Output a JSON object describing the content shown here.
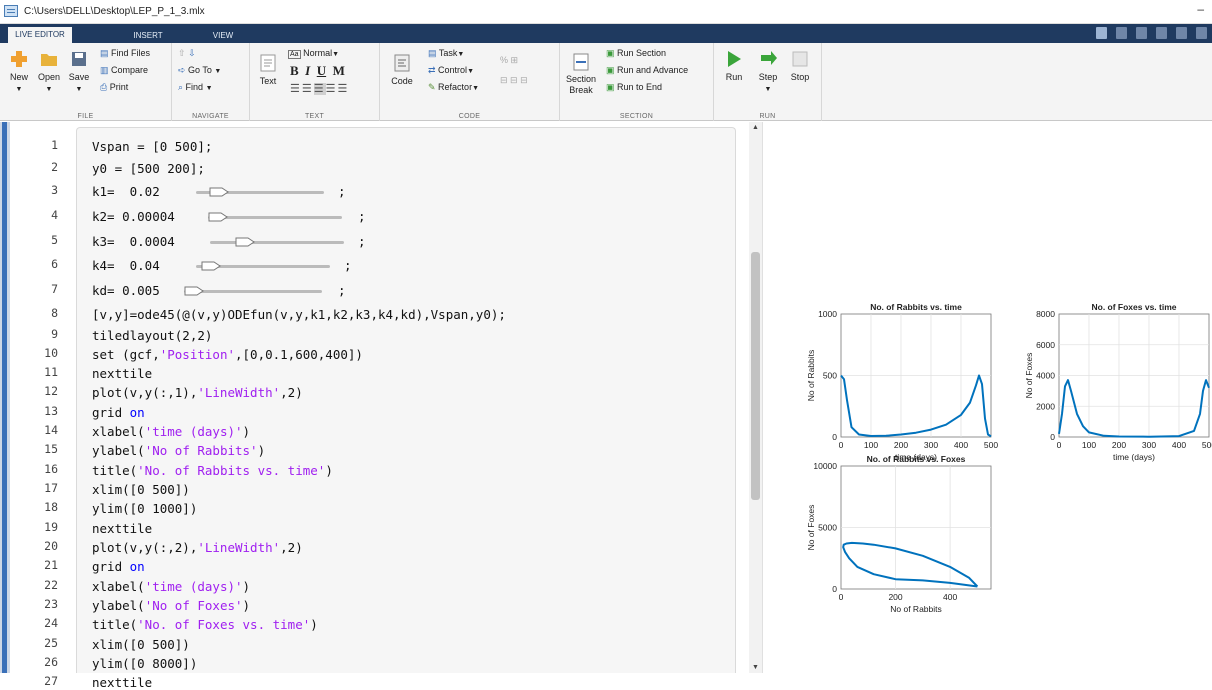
{
  "window": {
    "title": "C:\\Users\\DELL\\Desktop\\LEP_P_1_3.mlx",
    "minimize": "–"
  },
  "tabs": [
    "LIVE EDITOR",
    "INSERT",
    "VIEW"
  ],
  "ribbon": {
    "file": {
      "new": "New",
      "open": "Open",
      "save": "Save",
      "find_files": "Find Files",
      "compare": "Compare",
      "print": "Print",
      "label": "FILE"
    },
    "navigate": {
      "go_to": "Go To",
      "find": "Find",
      "label": "NAVIGATE"
    },
    "text": {
      "text": "Text",
      "style": "Normal",
      "bold": "B",
      "italic": "I",
      "underline": "U",
      "mono": "M",
      "label": "TEXT"
    },
    "code": {
      "code": "Code",
      "task": "Task",
      "control": "Control",
      "refactor": "Refactor",
      "percent": "%",
      "label": "CODE"
    },
    "section": {
      "section_break_1": "Section",
      "section_break_2": "Break",
      "run_section": "Run Section",
      "run_advance": "Run and Advance",
      "run_end": "Run to End",
      "label": "SECTION"
    },
    "run": {
      "run": "Run",
      "step": "Step",
      "stop": "Stop",
      "label": "RUN"
    }
  },
  "colors": {
    "accent": "#1f3a60",
    "plot_line": "#0072bd",
    "keyword": "#0000ff",
    "string": "#a020f0"
  },
  "editor": {
    "line_numbers": [
      "1",
      "2",
      "3",
      "4",
      "5",
      "6",
      "7",
      "8",
      "9",
      "10",
      "11",
      "12",
      "13",
      "14",
      "15",
      "16",
      "17",
      "18",
      "19",
      "20",
      "21",
      "22",
      "23",
      "24",
      "25",
      "26",
      "27"
    ],
    "lines": [
      "Vspan = [0 500];",
      "y0 = [500 200];",
      "k1=  0.02",
      "k2= 0.00004",
      "k3=  0.0004",
      "k4=  0.04",
      "kd= 0.005",
      "[v,y]=ode45(@(v,y)ODEfun(v,y,k1,k2,k3,k4,kd),Vspan,y0);",
      "tiledlayout(2,2)",
      "set (gcf,'Position',[0,0.1,600,400])",
      "nexttile",
      "plot(v,y(:,1),'LineWidth',2)",
      "grid on",
      "xlabel('time (days)')",
      "ylabel('No of Rabbits')",
      "title('No. of Rabbits vs. time')",
      "xlim([0 500])",
      "ylim([0 1000])",
      "nexttile",
      "plot(v,y(:,2),'LineWidth',2)",
      "grid on",
      "xlabel('time (days)')",
      "ylabel('No of Foxes')",
      "title('No. of Foxes vs. time')",
      "xlim([0 500])",
      "ylim([0 8000])",
      "nexttile"
    ],
    "sliders": [
      {
        "line": 3,
        "fraction": 0.12
      },
      {
        "line": 4,
        "fraction": 0.0
      },
      {
        "line": 5,
        "fraction": 0.22
      },
      {
        "line": 6,
        "fraction": 0.04
      },
      {
        "line": 7,
        "fraction": 0.0
      }
    ],
    "semicolon": ";"
  },
  "chart_data": [
    {
      "type": "line",
      "title": "No. of Rabbits vs. time",
      "xlabel": "time (days)",
      "ylabel": "No of Rabbits",
      "xlim": [
        0,
        500
      ],
      "ylim": [
        0,
        1000
      ],
      "xticks": [
        "0",
        "100",
        "200",
        "300",
        "400",
        "500"
      ],
      "yticks": [
        "0",
        "500",
        "1000"
      ],
      "grid": true,
      "series": [
        {
          "x": [
            0,
            10,
            20,
            35,
            60,
            100,
            150,
            200,
            250,
            300,
            350,
            400,
            430,
            450,
            460,
            470,
            480,
            490,
            500
          ],
          "values": [
            500,
            470,
            300,
            80,
            20,
            8,
            10,
            20,
            35,
            60,
            100,
            180,
            280,
            420,
            500,
            430,
            150,
            20,
            5
          ]
        }
      ]
    },
    {
      "type": "line",
      "title": "No. of Foxes vs. time",
      "xlabel": "time (days)",
      "ylabel": "No of Foxes",
      "xlim": [
        0,
        500
      ],
      "ylim": [
        0,
        8000
      ],
      "xticks": [
        "0",
        "100",
        "200",
        "300",
        "400",
        "500"
      ],
      "yticks": [
        "0",
        "2000",
        "4000",
        "6000",
        "8000"
      ],
      "grid": true,
      "series": [
        {
          "x": [
            0,
            10,
            20,
            30,
            40,
            60,
            80,
            100,
            150,
            200,
            300,
            400,
            450,
            470,
            480,
            490,
            500
          ],
          "values": [
            200,
            1500,
            3300,
            3700,
            3000,
            1500,
            700,
            300,
            80,
            30,
            20,
            60,
            400,
            1500,
            3000,
            3700,
            3200
          ]
        }
      ]
    },
    {
      "type": "line",
      "title": "No. of Rabbits vs. Foxes",
      "xlabel": "No of Rabbits",
      "ylabel": "No of Foxes",
      "xlim": [
        0,
        550
      ],
      "ylim": [
        0,
        10000
      ],
      "xticks": [
        "0",
        "200",
        "400"
      ],
      "yticks": [
        "0",
        "5000",
        "10000"
      ],
      "grid": true,
      "series": [
        {
          "x": [
            500,
            400,
            300,
            200,
            120,
            60,
            30,
            15,
            8,
            10,
            20,
            40,
            80,
            120,
            200,
            300,
            400,
            470,
            500
          ],
          "values": [
            200,
            500,
            700,
            800,
            1200,
            1800,
            2500,
            3000,
            3400,
            3600,
            3700,
            3750,
            3700,
            3600,
            3300,
            2700,
            1800,
            900,
            200
          ]
        }
      ]
    }
  ]
}
